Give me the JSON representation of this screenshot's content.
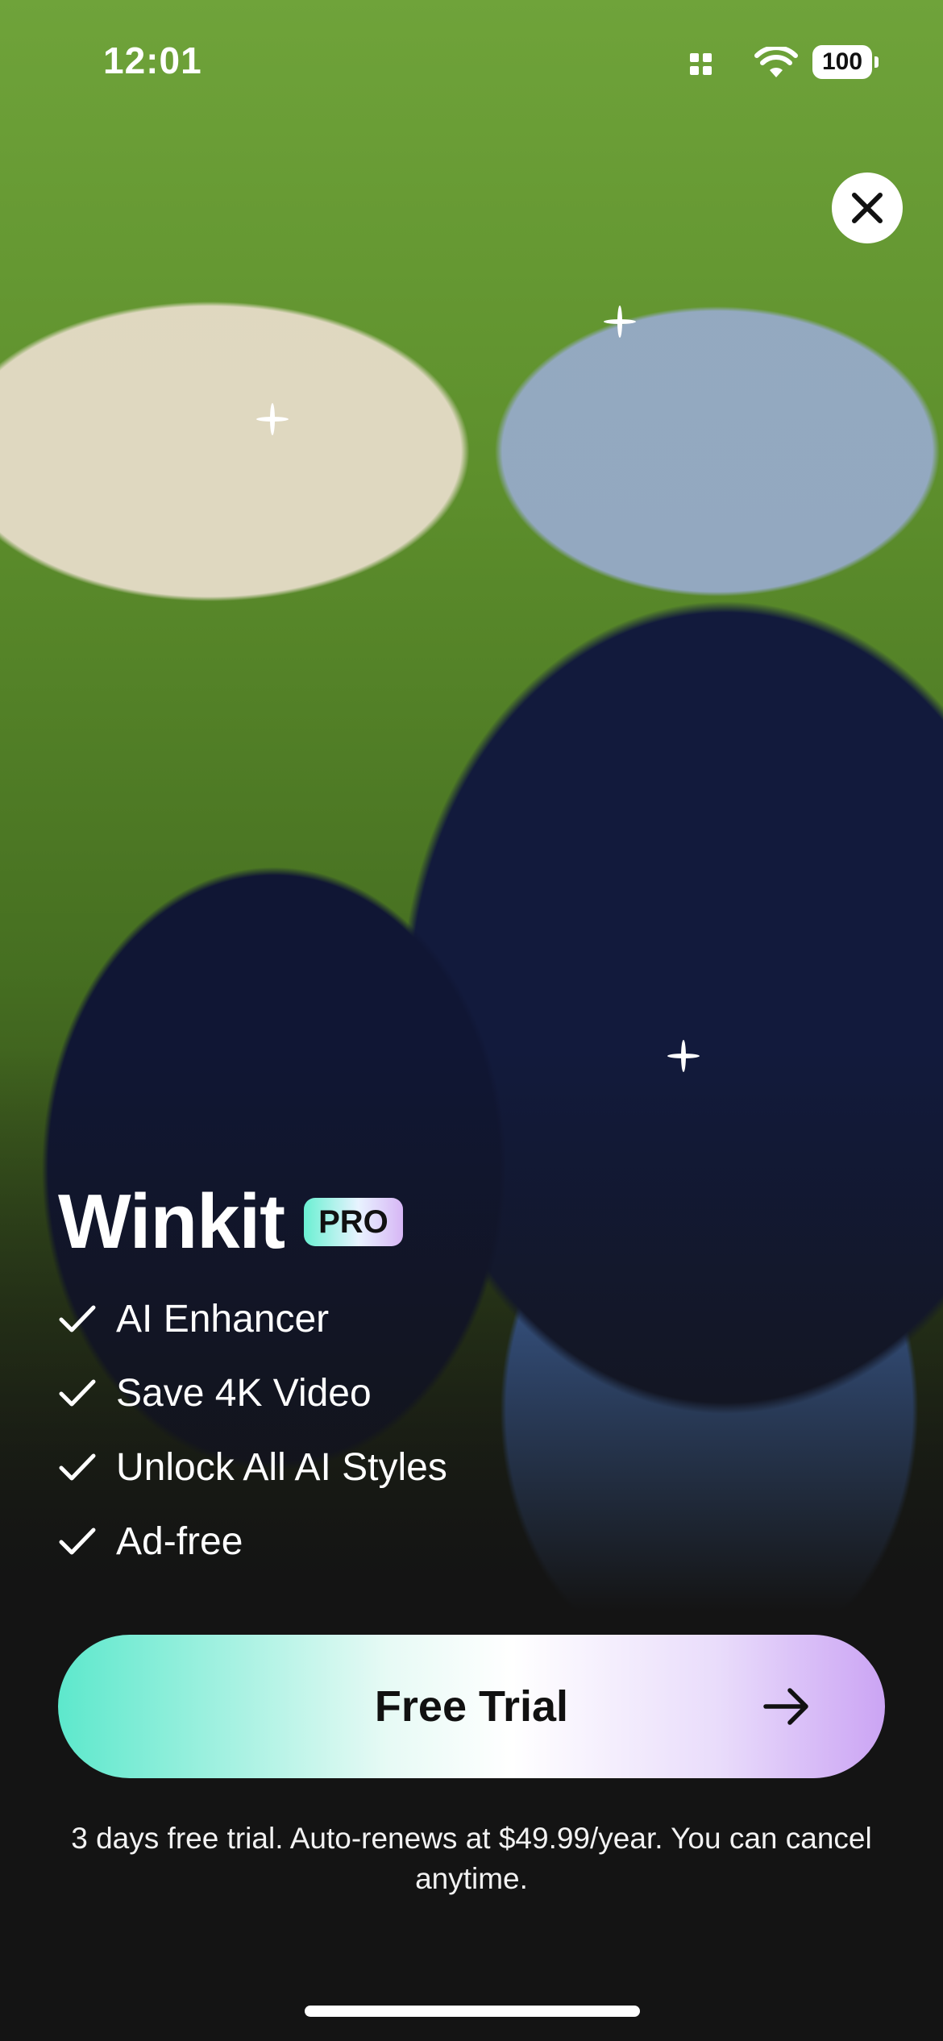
{
  "status_bar": {
    "time": "12:01",
    "battery": "100"
  },
  "brand": {
    "title": "Winkit",
    "badge": "PRO"
  },
  "features": [
    {
      "label": "AI Enhancer"
    },
    {
      "label": "Save 4K Video"
    },
    {
      "label": "Unlock All AI Styles"
    },
    {
      "label": "Ad-free"
    }
  ],
  "cta": {
    "label": "Free Trial"
  },
  "disclaimer": "3 days free trial. Auto-renews at $49.99/year. You can cancel anytime.",
  "icons": {
    "close": "close-icon",
    "check": "check-icon",
    "arrow": "arrow-right-icon",
    "signal": "signal-icon",
    "wifi": "wifi-icon",
    "battery": "battery-icon"
  },
  "colors": {
    "background": "#141414",
    "cta_gradient_start": "#5de8cc",
    "cta_gradient_end": "#cba4f4",
    "text": "#ffffff"
  }
}
